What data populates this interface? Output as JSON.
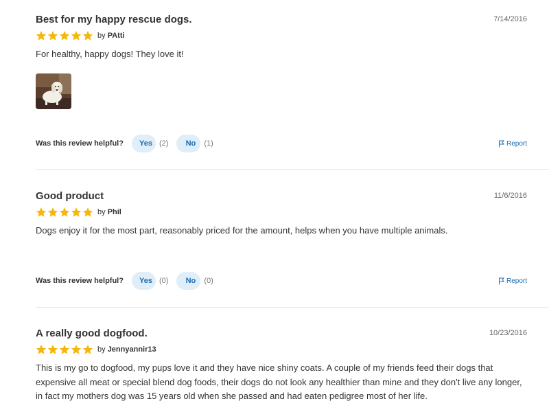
{
  "colors": {
    "accent": "#1b6bb0",
    "star": "#f5b70a",
    "button_bg": "#dfeef8"
  },
  "helpful_question": "Was this review helpful?",
  "yes_label": "Yes",
  "no_label": "No",
  "report_label": "Report",
  "reviews": [
    {
      "title": "Best for my happy rescue dogs.",
      "date": "7/14/2016",
      "rating": 5,
      "by": "by",
      "author": "PAtti",
      "body": "For healthy, happy dogs! They love it!",
      "has_photo": true,
      "yes_count": "(2)",
      "no_count": "(1)"
    },
    {
      "title": "Good product",
      "date": "11/6/2016",
      "rating": 5,
      "by": "by",
      "author": "Phil",
      "body": "Dogs enjoy it for the most part, reasonably priced for the amount, helps when you have multiple animals.",
      "yes_count": "(0)",
      "no_count": "(0)"
    },
    {
      "title": "A really good dogfood.",
      "date": "10/23/2016",
      "rating": 5,
      "by": "by",
      "author": "Jennyannir13",
      "body": "This is my go to dogfood, my pups love it and they have nice shiny coats. A couple of my friends feed their dogs that expensive all meat or special blend dog foods, their dogs do not look any healthier than mine and they don't live any longer, in fact my mothers dog was 15 years old when she passed and had eaten pedigree most of her life."
    }
  ]
}
